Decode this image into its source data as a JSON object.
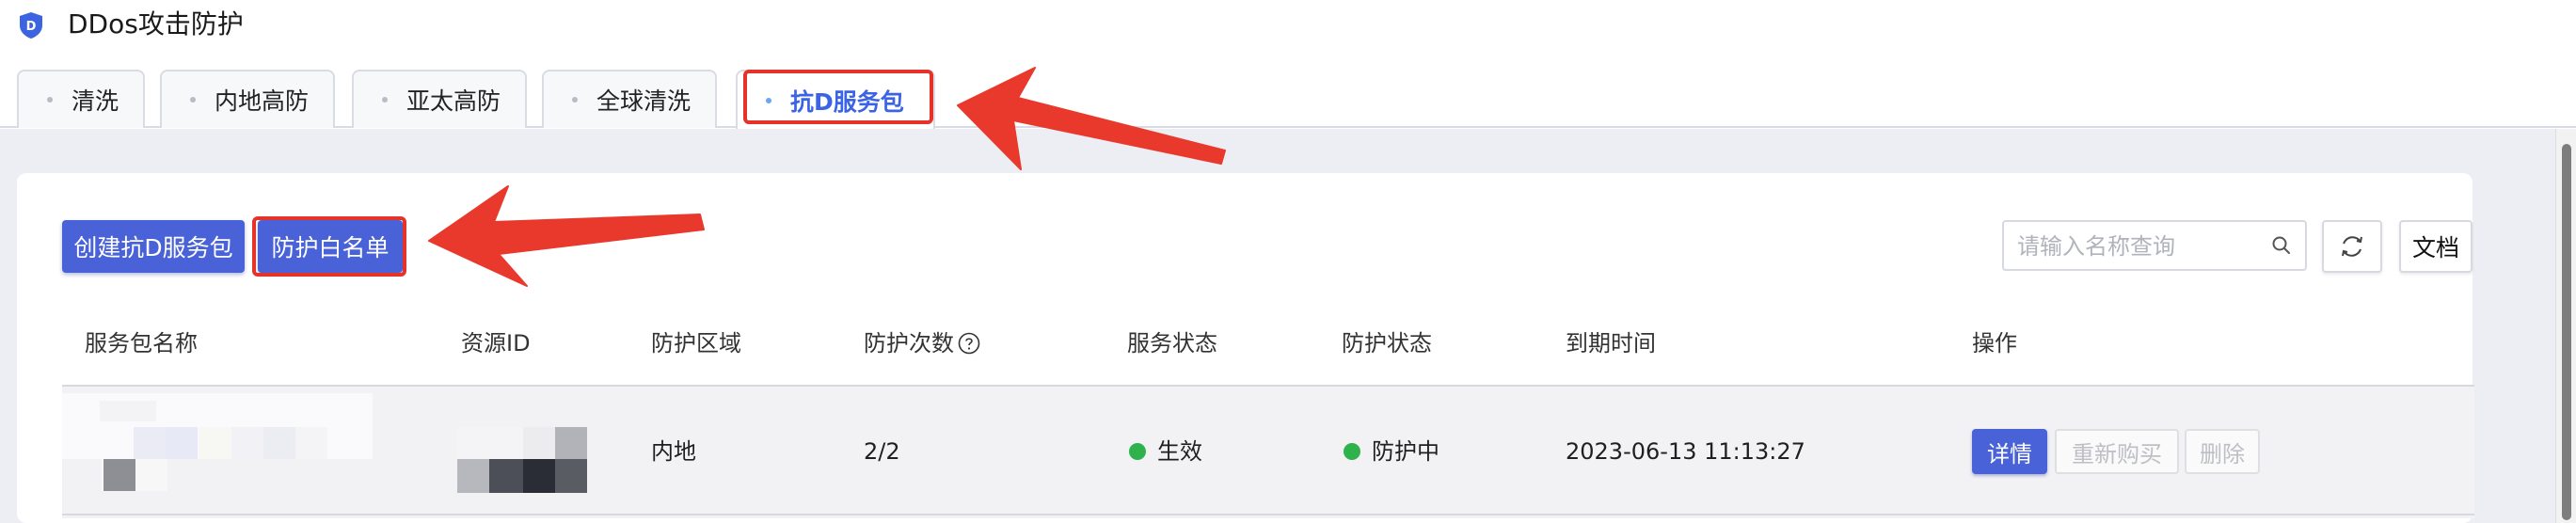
{
  "app": {
    "title": "DDos攻击防护",
    "logo_letter": "D"
  },
  "tabs": [
    {
      "label": "清洗",
      "active": false
    },
    {
      "label": "内地高防",
      "active": false
    },
    {
      "label": "亚太高防",
      "active": false
    },
    {
      "label": "全球清洗",
      "active": false
    },
    {
      "label": "抗D服务包",
      "active": true
    }
  ],
  "toolbar": {
    "create_label": "创建抗D服务包",
    "whitelist_label": "防护白名单",
    "search_placeholder": "请输入名称查询",
    "docs_label": "文档"
  },
  "table": {
    "columns": [
      "服务包名称",
      "资源ID",
      "防护区域",
      "防护次数",
      "服务状态",
      "防护状态",
      "到期时间",
      "操作"
    ],
    "rows": [
      {
        "region": "内地",
        "protection_count": "2/2",
        "service_status": "生效",
        "protection_status": "防护中",
        "expiry": "2023-06-13 11:13:27",
        "actions": {
          "detail": "详情",
          "renew": "重新购买",
          "delete": "删除"
        }
      }
    ]
  },
  "colors": {
    "accent": "#4a62d8",
    "active_tab": "#3b63e6",
    "status_green": "#2fb14c",
    "annotation_red": "#e6332a"
  }
}
